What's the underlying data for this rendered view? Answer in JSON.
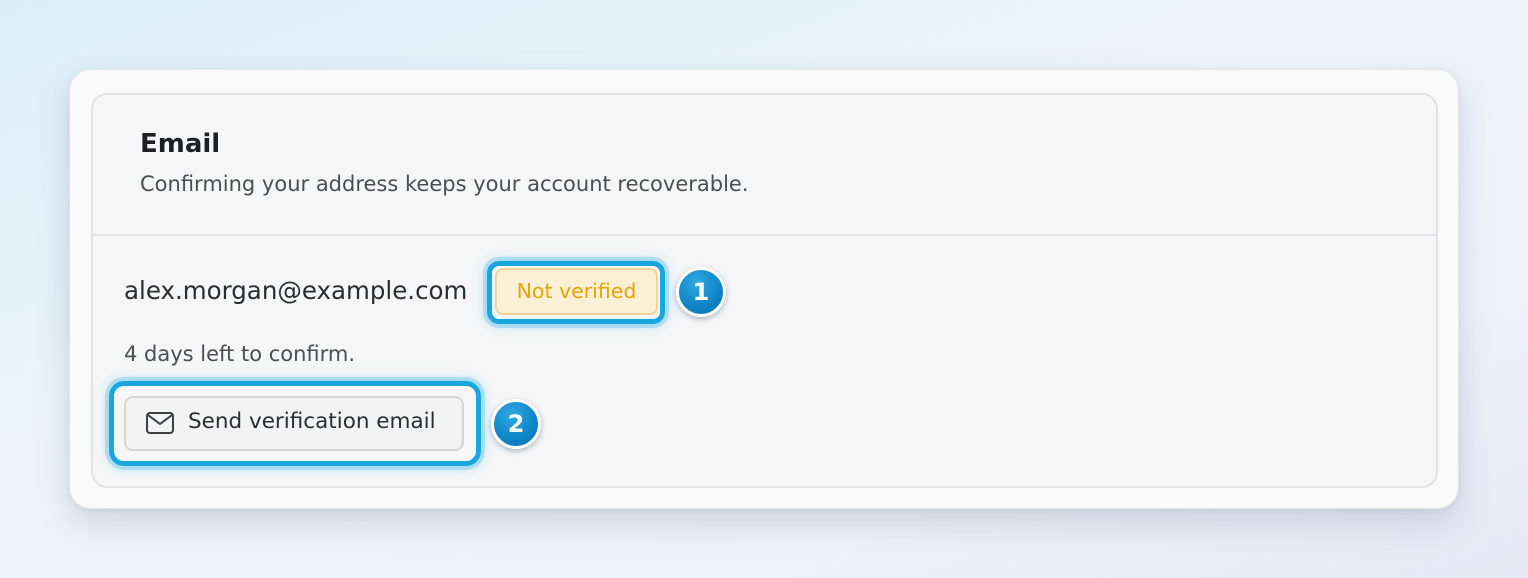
{
  "section": {
    "title": "Email",
    "subtitle": "Confirming your address keeps your account recoverable."
  },
  "account": {
    "email": "alex.morgan@example.com",
    "status_badge": "Not verified",
    "countdown": "4 days left to confirm."
  },
  "actions": {
    "send_verification_label": "Send verification email",
    "send_verification_icon": "mail-icon"
  },
  "annotations": {
    "markers": [
      "1",
      "2"
    ],
    "highlight_color": "#1aa7df"
  },
  "colors": {
    "badge_text": "#e6a400",
    "badge_background": "#fbf0d6",
    "marker": "#1087c8"
  }
}
